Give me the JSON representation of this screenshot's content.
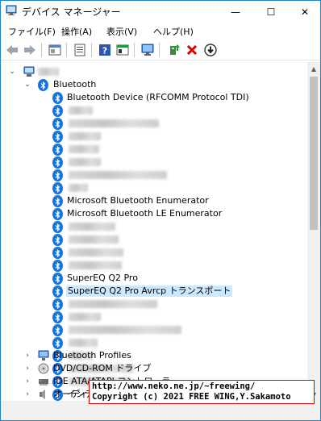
{
  "window": {
    "title": "デバイス マネージャー",
    "minimize": "—",
    "maximize": "☐",
    "close": "✕"
  },
  "menu": [
    "ファイル(F)",
    "操作(A)",
    "表示(V)",
    "ヘルプ(H)"
  ],
  "tree": {
    "bluetooth_category": "Bluetooth",
    "bt_device_rfcomm": "Bluetooth Device (RFCOMM Protocol TDI)",
    "ms_bt_enum": "Microsoft Bluetooth Enumerator",
    "ms_bt_le_enum": "Microsoft Bluetooth LE Enumerator",
    "supereq_q2": "SuperEQ Q2 Pro",
    "supereq_avrcp": "SuperEQ Q2 Pro Avrcp トランスポート",
    "intel_wireless_bt": "インテル(R) ワイヤレス Bluetooth(R)",
    "bt_profiles": "Bluetooth Profiles",
    "dvd_drive": "DVD/CD-ROM ドライブ",
    "ide_controller": "IDE ATA/ATAPI コントローラー",
    "audio_io": "オーディオの入力および出力"
  },
  "watermark": {
    "line1": "http://www.neko.ne.jp/~freewing/",
    "line2": "Copyright (c) 2021 FREE WING,Y.Sakamoto"
  },
  "colors": {
    "bluetooth_blue": "#1a73d9",
    "selection": "#cce8ff",
    "watermark_border": "#e00000"
  }
}
